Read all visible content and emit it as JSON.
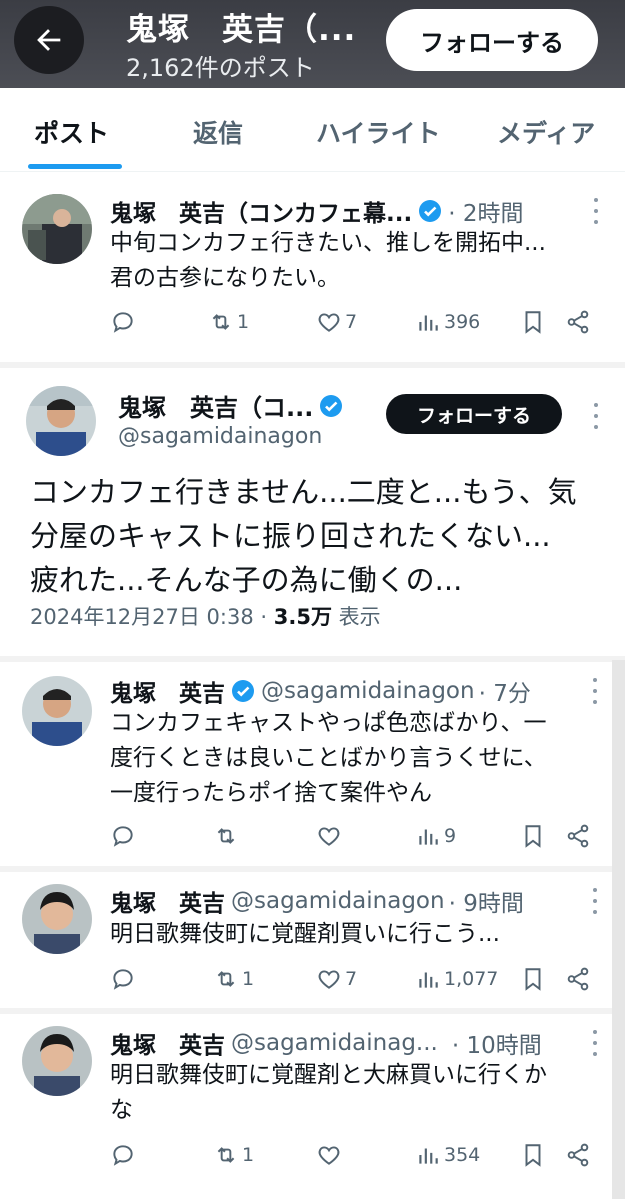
{
  "header": {
    "display_name": "鬼塚　英吉（...",
    "post_count": "2,162件のポスト",
    "follow_label": "フォローする"
  },
  "tabs": [
    {
      "label": "ポスト",
      "active": true
    },
    {
      "label": "返信",
      "active": false
    },
    {
      "label": "ハイライト",
      "active": false
    },
    {
      "label": "メディア",
      "active": false
    }
  ],
  "posts": [
    {
      "name": "鬼塚　英吉（コンカフェ幕...",
      "handle": "",
      "time": "· 2時間",
      "verified": true,
      "text": [
        "中旬コンカフェ行きたい、推しを開拓中...",
        "君の古参になりたい。"
      ],
      "replies": "",
      "reposts": "1",
      "likes": "7",
      "views": "396"
    },
    {
      "name": "鬼塚　英吉",
      "handle": "@sagamidainagon",
      "time": "· 7分",
      "verified": true,
      "text": [
        "コンカフェキャストやっぱ色恋ばかり、一",
        "度行くときは良いことばかり言うくせに、",
        "一度行ったらポイ捨て案件やん"
      ],
      "replies": "",
      "reposts": "",
      "likes": "",
      "views": "9"
    },
    {
      "name": "鬼塚　英吉",
      "handle": "@sagamidainagon",
      "time": "· 9時間",
      "verified": false,
      "text": [
        "明日歌舞伎町に覚醒剤買いに行こう..."
      ],
      "replies": "",
      "reposts": "1",
      "likes": "7",
      "views": "1,077"
    },
    {
      "name": "鬼塚　英吉",
      "handle": "@sagamidainag...",
      "time": "· 10時間",
      "verified": false,
      "text": [
        "明日歌舞伎町に覚醒剤と大麻買いに行くか",
        "な"
      ],
      "replies": "",
      "reposts": "1",
      "likes": "",
      "views": "354"
    }
  ],
  "focus_post": {
    "name": "鬼塚　英吉（コ...",
    "handle": "@sagamidainagon",
    "follow_label": "フォローする",
    "text": [
      "コンカフェ行きません...二度と...もう、気",
      "分屋のキャストに振り回されたくない...",
      "疲れた...そんな子の為に働くの..."
    ],
    "date": "2024年12月27日 0:38 · ",
    "views": "3.5万",
    "views_label": " 表示"
  },
  "colors": {
    "accent": "#1d9bf0",
    "text": "#0f1419",
    "muted": "#536471"
  }
}
